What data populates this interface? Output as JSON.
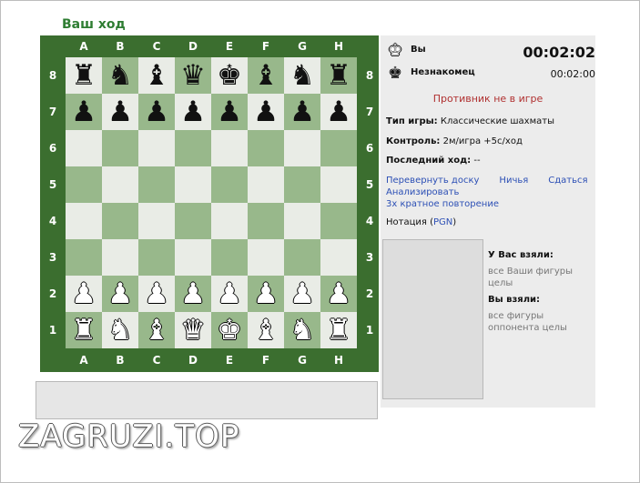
{
  "turn_title": "Ваш ход",
  "board": {
    "files": [
      "A",
      "B",
      "C",
      "D",
      "E",
      "F",
      "G",
      "H"
    ],
    "ranks": [
      "8",
      "7",
      "6",
      "5",
      "4",
      "3",
      "2",
      "1"
    ],
    "light_color": "#e9ece6",
    "dark_color": "#98b88b",
    "frame_color": "#3b6e2f",
    "rows": [
      [
        "r",
        "n",
        "b",
        "q",
        "k",
        "b",
        "n",
        "r"
      ],
      [
        "p",
        "p",
        "p",
        "p",
        "p",
        "p",
        "p",
        "p"
      ],
      [
        "",
        "",
        "",
        "",
        "",
        "",
        "",
        ""
      ],
      [
        "",
        "",
        "",
        "",
        "",
        "",
        "",
        ""
      ],
      [
        "",
        "",
        "",
        "",
        "",
        "",
        "",
        ""
      ],
      [
        "",
        "",
        "",
        "",
        "",
        "",
        "",
        ""
      ],
      [
        "P",
        "P",
        "P",
        "P",
        "P",
        "P",
        "P",
        "P"
      ],
      [
        "R",
        "N",
        "B",
        "Q",
        "K",
        "B",
        "N",
        "R"
      ]
    ]
  },
  "players": {
    "you": {
      "name": "Вы",
      "time": "00:02:02",
      "icon": "white-king-icon"
    },
    "opponent": {
      "name": "Незнакомец",
      "time": "00:02:00",
      "icon": "black-king-icon"
    }
  },
  "opponent_status": "Противник не в игре",
  "game_info": {
    "type_label": "Тип игры:",
    "type_value": "Классические шахматы",
    "control_label": "Контроль:",
    "control_value": "2м/игра +5с/ход",
    "last_move_label": "Последний ход:",
    "last_move_value": "--"
  },
  "actions": {
    "flip": "Перевернуть доску",
    "draw": "Ничья",
    "resign": "Сдаться",
    "analyze": "Анализировать",
    "threefold": "3х кратное повторение"
  },
  "notation": {
    "label": "Нотация (",
    "link": "PGN",
    "close": ")"
  },
  "captured": {
    "from_you_title": "У Вас взяли:",
    "from_you_text": "все Ваши фигуры целы",
    "by_you_title": "Вы взяли:",
    "by_you_text": "все фигуры оппонента целы"
  },
  "watermark": "ZAGRUZI.TOP"
}
